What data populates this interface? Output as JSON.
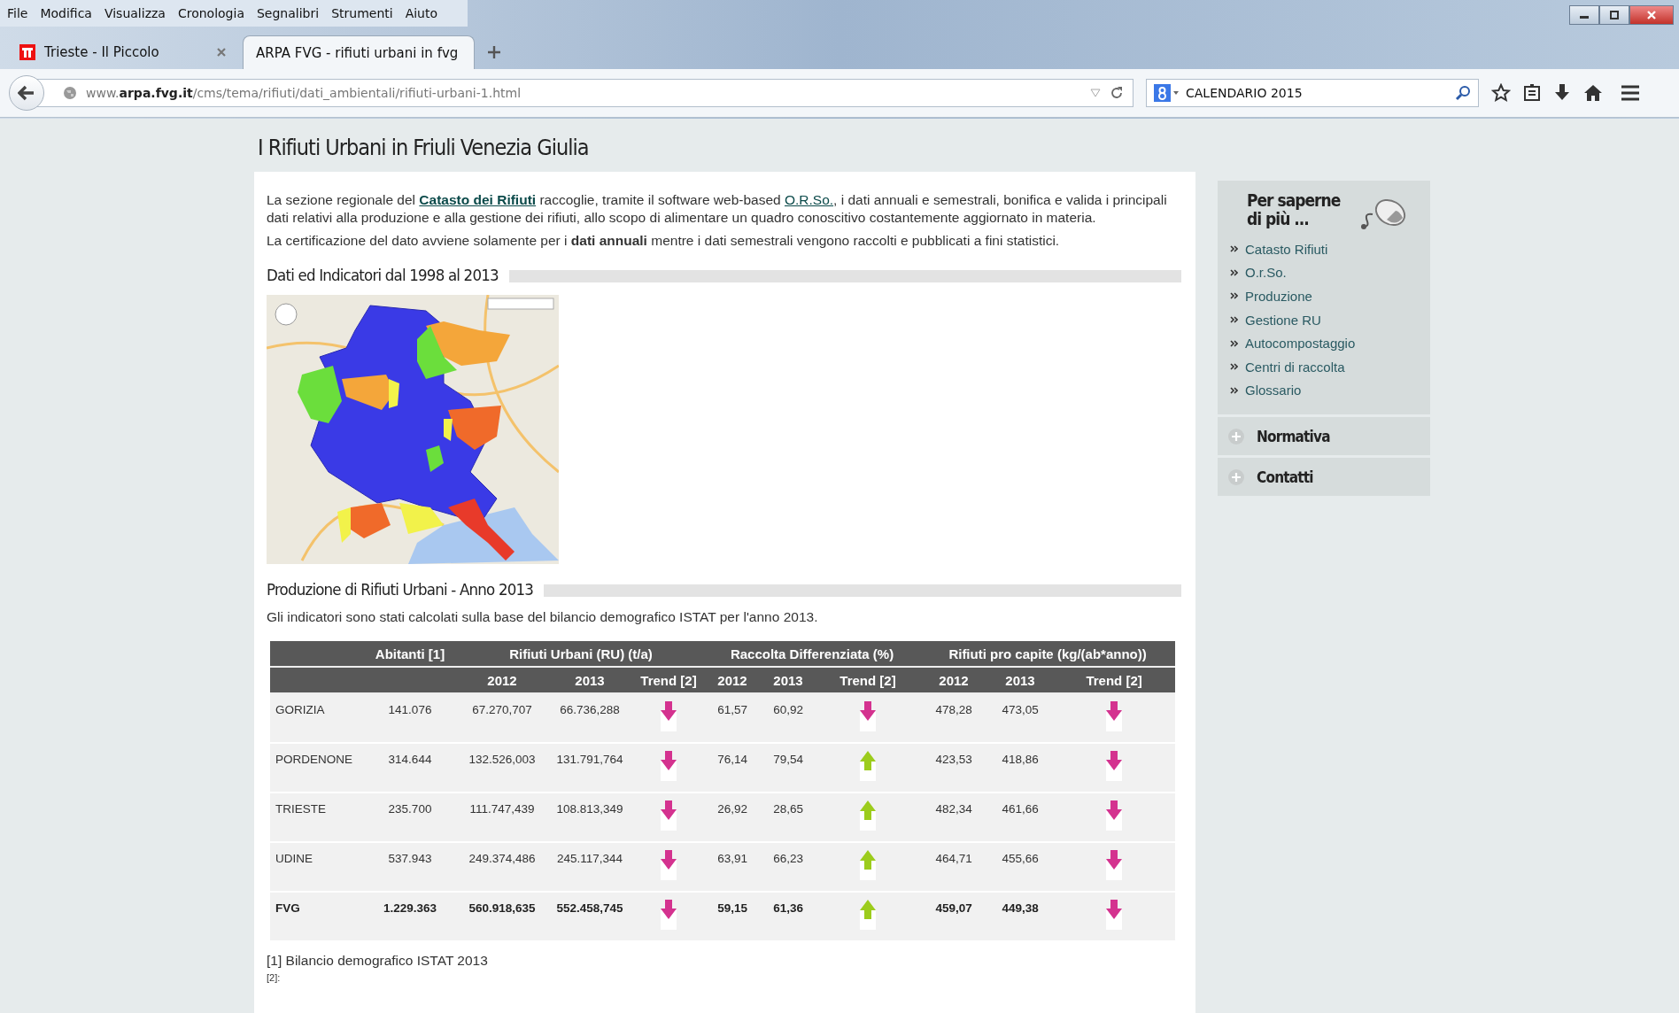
{
  "menu_bar": [
    "File",
    "Modifica",
    "Visualizza",
    "Cronologia",
    "Segnalibri",
    "Strumenti",
    "Aiuto"
  ],
  "tabs": [
    {
      "label": "Trieste - Il Piccolo",
      "selected": false
    },
    {
      "label": "ARPA FVG - rifiuti urbani in fvg",
      "selected": true
    }
  ],
  "address_bar": {
    "url": "www.**arpa.fvg.it**/cms/tema/rifiuti/dati_ambientali/rifiuti-urbani-1.html"
  },
  "search": {
    "value": "CALENDARIO 2015"
  },
  "page": {
    "title": "I Rifiuti Urbani in Friuli Venezia Giulia",
    "intro": [
      {
        "kind": "links",
        "parts": [
          "La sezione regionale del ",
          "Catasto dei Rifiuti",
          " raccoglie, tramite il software web-based ",
          "O.R.So.",
          ", i dati annuali e semestrali, bonifica e valida i principali dati relativi alla produzione e alla gestione dei rifiuti, allo scopo di alimentare un quadro conoscitivo costantemente aggiornato in materia."
        ]
      },
      {
        "kind": "text",
        "text": "La certificazione del dato avviene solamente per i **dati annuali** mentre i dati semestrali vengono raccolti e pubblicati a fini statistici."
      }
    ],
    "section1": {
      "heading": "Dati ed Indicatori dal 1998 al 2013"
    },
    "section2": {
      "heading": "Produzione di Rifiuti Urbani - Anno 2013",
      "note": "Gli indicatori sono stati calcolati sulla base del bilancio demografico ISTAT per l'anno 2013."
    },
    "table": {
      "group_headers": [
        "Abitanti [1]",
        "Rifiuti Urbani (RU) (t/a)",
        "Raccolta Differenziata (%)",
        "Rifiuti pro capite (kg/(ab*anno))"
      ],
      "sub_headers": [
        "2012",
        "2013",
        "Trend [2]",
        "2012",
        "2013",
        "Trend [2]",
        "2012",
        "2013",
        "Trend [2]"
      ],
      "rows": [
        {
          "total": false,
          "cells": [
            "GORIZIA",
            "141.076",
            "67.270,707",
            "66.736,288",
            "61,57",
            "60,92",
            "478,28",
            "473,05"
          ],
          "trends": [
            {
              "rising": false
            },
            {
              "rising": false
            },
            {
              "rising": false
            }
          ]
        },
        {
          "total": false,
          "cells": [
            "PORDENONE",
            "314.644",
            "132.526,003",
            "131.791,764",
            "76,14",
            "79,54",
            "423,53",
            "418,86"
          ],
          "trends": [
            {
              "rising": false
            },
            {
              "rising": true
            },
            {
              "rising": false
            }
          ]
        },
        {
          "total": false,
          "cells": [
            "TRIESTE",
            "235.700",
            "111.747,439",
            "108.813,349",
            "26,92",
            "28,65",
            "482,34",
            "461,66"
          ],
          "trends": [
            {
              "rising": false
            },
            {
              "rising": true
            },
            {
              "rising": false
            }
          ]
        },
        {
          "total": false,
          "cells": [
            "UDINE",
            "537.943",
            "249.374,486",
            "245.117,344",
            "63,91",
            "66,23",
            "464,71",
            "455,66"
          ],
          "trends": [
            {
              "rising": false
            },
            {
              "rising": true
            },
            {
              "rising": false
            }
          ]
        },
        {
          "total": true,
          "cells": [
            "FVG",
            "1.229.363",
            "560.918,635",
            "552.458,745",
            "59,15",
            "61,36",
            "459,07",
            "449,38"
          ],
          "trends": [
            {
              "rising": false
            },
            {
              "rising": true
            },
            {
              "rising": false
            }
          ]
        }
      ]
    },
    "footnotes": [
      "[1] Bilancio demografico ISTAT 2013",
      "[2]:"
    ]
  },
  "sidebar": {
    "heading": "Per saperne di più ...",
    "links": [
      "Catasto Rifiuti",
      "O.r.So.",
      "Produzione",
      "Gestione RU",
      "Autocompostaggio",
      "Centri di raccolta",
      "Glossario"
    ],
    "sections": [
      {
        "label": "Normativa",
        "expanded": false
      },
      {
        "label": "Contatti",
        "expanded": false
      }
    ]
  }
}
